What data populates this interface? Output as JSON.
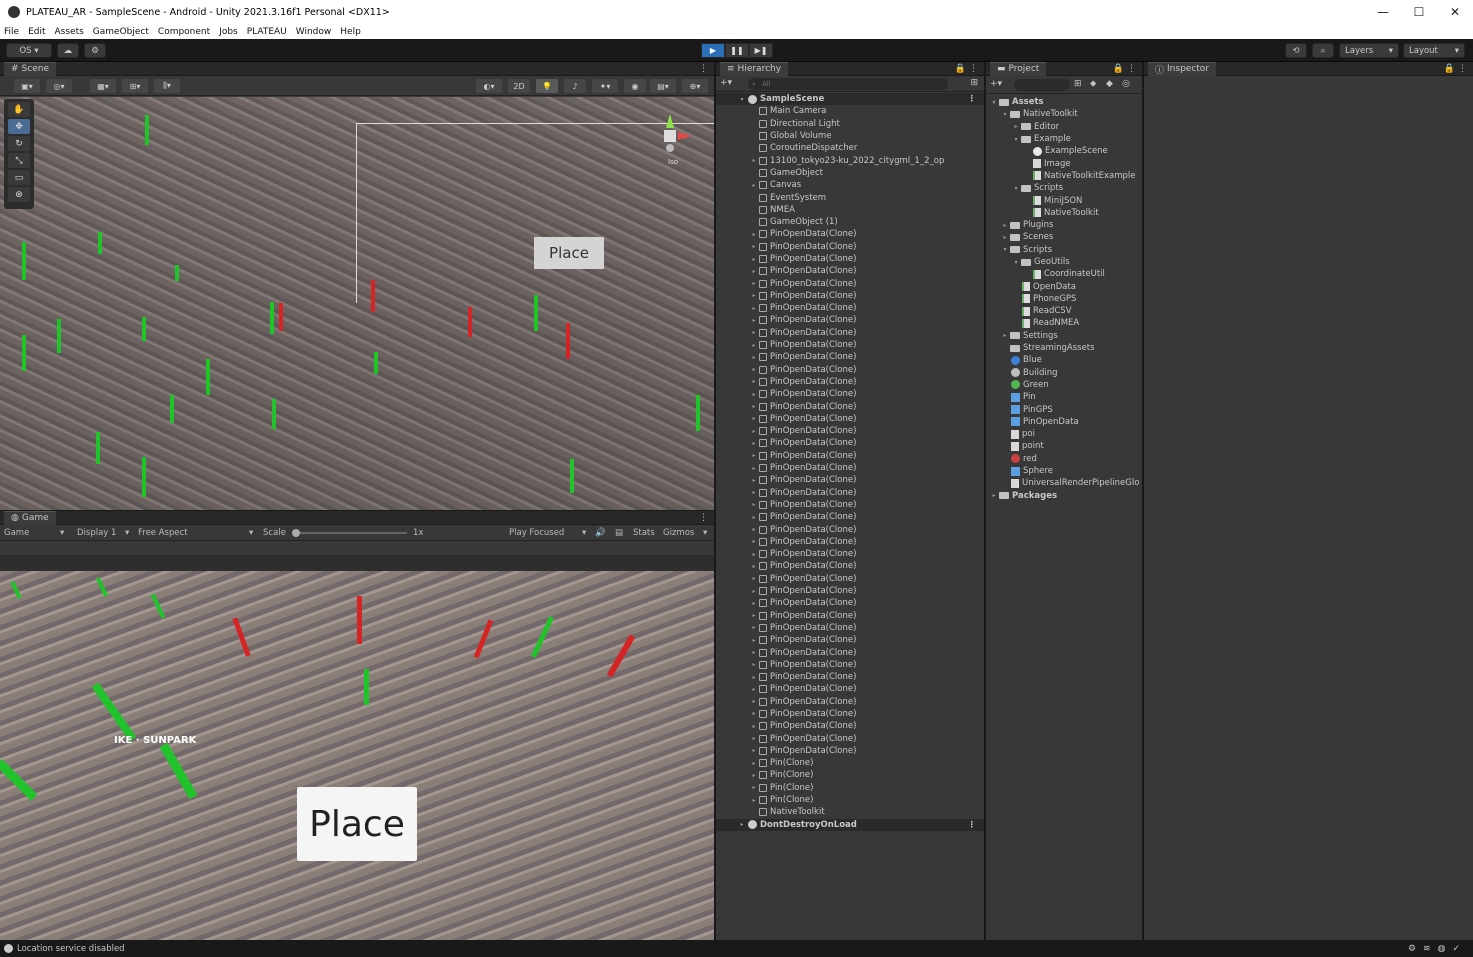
{
  "window": {
    "title": "PLATEAU_AR - SampleScene - Android - Unity 2021.3.16f1 Personal <DX11>",
    "minimize": "—",
    "maximize": "☐",
    "close": "✕"
  },
  "menu": [
    "File",
    "Edit",
    "Assets",
    "GameObject",
    "Component",
    "Jobs",
    "PLATEAU",
    "Window",
    "Help"
  ],
  "toolbar": {
    "account": "OS ▾",
    "layers": "Layers",
    "layout": "Layout"
  },
  "scene": {
    "tab": "Scene",
    "mode_2d": "2D",
    "place_button": "Place",
    "persp_label": "Iso"
  },
  "game": {
    "tab": "Game",
    "mode": "Game",
    "display": "Display 1",
    "aspect": "Free Aspect",
    "scale_label": "Scale",
    "scale_value": "1x",
    "play_focused": "Play Focused",
    "stats": "Stats",
    "gizmos": "Gizmos",
    "place_button": "Place",
    "sunpark_label": "IKE · SUNPARK"
  },
  "hierarchy": {
    "tab": "Hierarchy",
    "search_placeholder": "All",
    "scene_name": "SampleScene",
    "items": [
      "Main Camera",
      "Directional Light",
      "Global Volume",
      "CoroutineDispatcher",
      "13100_tokyo23-ku_2022_citygml_1_2_op",
      "GameObject",
      "Canvas",
      "EventSystem",
      "NMEA",
      "GameObject (1)",
      "PinOpenData(Clone)",
      "PinOpenData(Clone)",
      "PinOpenData(Clone)",
      "PinOpenData(Clone)",
      "PinOpenData(Clone)",
      "PinOpenData(Clone)",
      "PinOpenData(Clone)",
      "PinOpenData(Clone)",
      "PinOpenData(Clone)",
      "PinOpenData(Clone)",
      "PinOpenData(Clone)",
      "PinOpenData(Clone)",
      "PinOpenData(Clone)",
      "PinOpenData(Clone)",
      "PinOpenData(Clone)",
      "PinOpenData(Clone)",
      "PinOpenData(Clone)",
      "PinOpenData(Clone)",
      "PinOpenData(Clone)",
      "PinOpenData(Clone)",
      "PinOpenData(Clone)",
      "PinOpenData(Clone)",
      "PinOpenData(Clone)",
      "PinOpenData(Clone)",
      "PinOpenData(Clone)",
      "PinOpenData(Clone)",
      "PinOpenData(Clone)",
      "PinOpenData(Clone)",
      "PinOpenData(Clone)",
      "PinOpenData(Clone)",
      "PinOpenData(Clone)",
      "PinOpenData(Clone)",
      "PinOpenData(Clone)",
      "PinOpenData(Clone)",
      "PinOpenData(Clone)",
      "PinOpenData(Clone)",
      "PinOpenData(Clone)",
      "PinOpenData(Clone)",
      "PinOpenData(Clone)",
      "PinOpenData(Clone)",
      "PinOpenData(Clone)",
      "PinOpenData(Clone)",
      "PinOpenData(Clone)",
      "Pin(Clone)",
      "Pin(Clone)",
      "Pin(Clone)",
      "Pin(Clone)",
      "NativeToolkit"
    ],
    "dont_destroy": "DontDestroyOnLoad"
  },
  "project": {
    "tab": "Project",
    "rows": [
      {
        "indent": 0,
        "arrow": "▾",
        "icon": "folder",
        "label": "Assets",
        "bold": true
      },
      {
        "indent": 1,
        "arrow": "▾",
        "icon": "folder",
        "label": "NativeToolkit"
      },
      {
        "indent": 2,
        "arrow": "▸",
        "icon": "folder",
        "label": "Editor"
      },
      {
        "indent": 2,
        "arrow": "▾",
        "icon": "folder",
        "label": "Example"
      },
      {
        "indent": 3,
        "arrow": "",
        "icon": "uni",
        "label": "ExampleScene"
      },
      {
        "indent": 3,
        "arrow": "",
        "icon": "file",
        "label": "Image"
      },
      {
        "indent": 3,
        "arrow": "",
        "icon": "cs",
        "label": "NativeToolkitExample"
      },
      {
        "indent": 2,
        "arrow": "▾",
        "icon": "folder",
        "label": "Scripts"
      },
      {
        "indent": 3,
        "arrow": "",
        "icon": "cs",
        "label": "MiniJSON"
      },
      {
        "indent": 3,
        "arrow": "",
        "icon": "cs",
        "label": "NativeToolkit"
      },
      {
        "indent": 1,
        "arrow": "▸",
        "icon": "folder",
        "label": "Plugins"
      },
      {
        "indent": 1,
        "arrow": "▸",
        "icon": "folder",
        "label": "Scenes"
      },
      {
        "indent": 1,
        "arrow": "▾",
        "icon": "folder",
        "label": "Scripts"
      },
      {
        "indent": 2,
        "arrow": "▾",
        "icon": "folder",
        "label": "GeoUtils"
      },
      {
        "indent": 3,
        "arrow": "",
        "icon": "cs",
        "label": "CoordinateUtil"
      },
      {
        "indent": 2,
        "arrow": "",
        "icon": "cs",
        "label": "OpenData"
      },
      {
        "indent": 2,
        "arrow": "",
        "icon": "cs",
        "label": "PhoneGPS"
      },
      {
        "indent": 2,
        "arrow": "",
        "icon": "cs",
        "label": "ReadCSV"
      },
      {
        "indent": 2,
        "arrow": "",
        "icon": "cs",
        "label": "ReadNMEA"
      },
      {
        "indent": 1,
        "arrow": "▸",
        "icon": "folder",
        "label": "Settings"
      },
      {
        "indent": 1,
        "arrow": "",
        "icon": "folder",
        "label": "StreamingAssets"
      },
      {
        "indent": 1,
        "arrow": "",
        "icon": "mat",
        "color": "#3f7fd8",
        "label": "Blue"
      },
      {
        "indent": 1,
        "arrow": "",
        "icon": "mat",
        "color": "#bdbdbd",
        "label": "Building"
      },
      {
        "indent": 1,
        "arrow": "",
        "icon": "mat",
        "color": "#4fb84f",
        "label": "Green"
      },
      {
        "indent": 1,
        "arrow": "",
        "icon": "prefab",
        "label": "Pin"
      },
      {
        "indent": 1,
        "arrow": "",
        "icon": "prefab",
        "label": "PinGPS"
      },
      {
        "indent": 1,
        "arrow": "",
        "icon": "prefab",
        "label": "PinOpenData"
      },
      {
        "indent": 1,
        "arrow": "",
        "icon": "file",
        "label": "poi"
      },
      {
        "indent": 1,
        "arrow": "",
        "icon": "file",
        "label": "point"
      },
      {
        "indent": 1,
        "arrow": "",
        "icon": "mat",
        "color": "#c94040",
        "label": "red"
      },
      {
        "indent": 1,
        "arrow": "",
        "icon": "prefab",
        "label": "Sphere"
      },
      {
        "indent": 1,
        "arrow": "",
        "icon": "file",
        "label": "UniversalRenderPipelineGlo"
      },
      {
        "indent": 0,
        "arrow": "▸",
        "icon": "folder",
        "label": "Packages",
        "bold": true
      }
    ]
  },
  "inspector": {
    "tab": "Inspector"
  },
  "status": {
    "message": "Location service disabled"
  }
}
